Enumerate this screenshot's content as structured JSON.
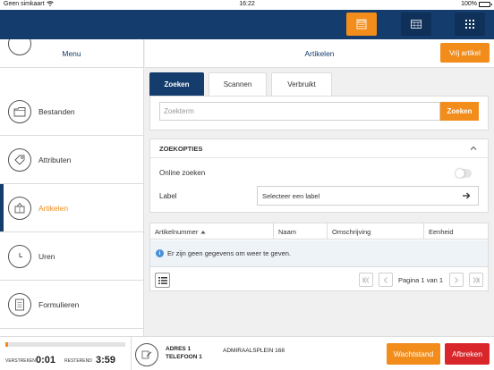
{
  "status_bar": {
    "carrier": "Geen simkaart",
    "time": "16:22",
    "battery": "100%",
    "battery_level": 1.0
  },
  "sidebar": {
    "title": "Menu",
    "items": [
      {
        "label": "",
        "icon": "partial-icon"
      },
      {
        "label": "Bestanden",
        "icon": "folder-icon"
      },
      {
        "label": "Attributen",
        "icon": "tag-icon"
      },
      {
        "label": "Artikelen",
        "icon": "package-icon",
        "active": true
      },
      {
        "label": "Uren",
        "icon": "clock-icon"
      },
      {
        "label": "Formulieren",
        "icon": "document-icon"
      }
    ]
  },
  "main": {
    "title": "Artikelen",
    "add_button": "Vrij artikel",
    "tabs": [
      {
        "label": "Zoeken",
        "active": true
      },
      {
        "label": "Scannen",
        "active": false
      },
      {
        "label": "Verbruikt",
        "active": false
      }
    ],
    "search": {
      "placeholder": "Zoekterm",
      "button": "Zoeken"
    },
    "options": {
      "title": "ZOEKOPTIES",
      "online_label": "Online zoeken",
      "online_enabled": false,
      "label_label": "Label",
      "label_select": "Selecteer een label"
    },
    "table": {
      "columns": [
        "Artikelnummer",
        "Naam",
        "Omschrijving",
        "Eenheid"
      ],
      "sort_column": "Artikelnummer",
      "empty_message": "Er zijn geen gegevens om weer te geven.",
      "pagination": "Pagina 1 van 1"
    }
  },
  "footer": {
    "progress": 0.01,
    "elapsed_label": "VERSTREKEN",
    "elapsed": "0:01",
    "remaining_label": "RESTEREND",
    "remaining": "3:59",
    "address_line": "ADRES 1",
    "phone_line": "TELEFOON 1",
    "street": "ADMIRAALSPLEIN 168",
    "wait_button": "Wachtstand",
    "cancel_button": "Afbreken"
  },
  "colors": {
    "navy": "#143c6c",
    "orange": "#f28c1a",
    "red": "#d9262b"
  }
}
